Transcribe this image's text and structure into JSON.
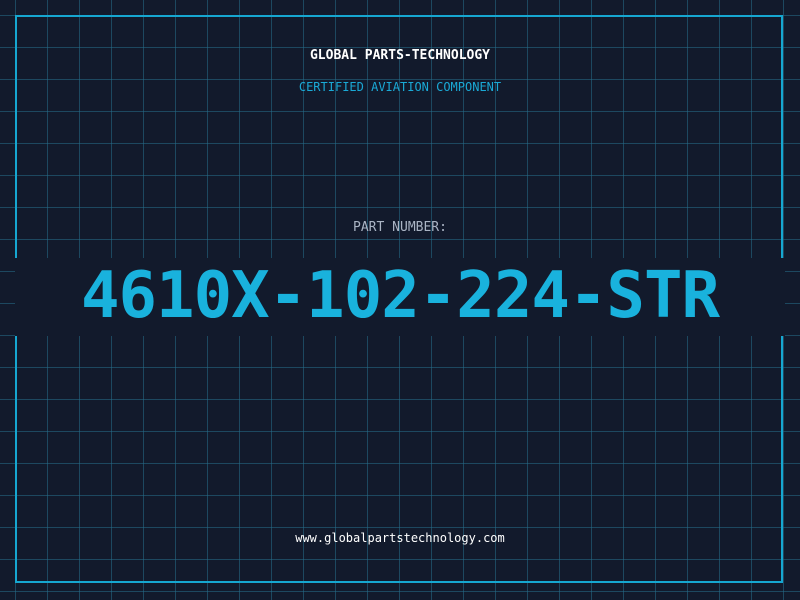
{
  "header": {
    "brand": "GLOBAL PARTS-TECHNOLOGY",
    "tagline": "CERTIFIED AVIATION COMPONENT"
  },
  "part": {
    "label": "PART NUMBER:",
    "number": "4610X-102-224-STR"
  },
  "footer": {
    "url": "www.globalpartstechnology.com"
  },
  "colors": {
    "background": "#121a2c",
    "grid": "#266e8a",
    "accent": "#16a7d1",
    "text": "#ffffff",
    "muted": "#aab4c4"
  }
}
